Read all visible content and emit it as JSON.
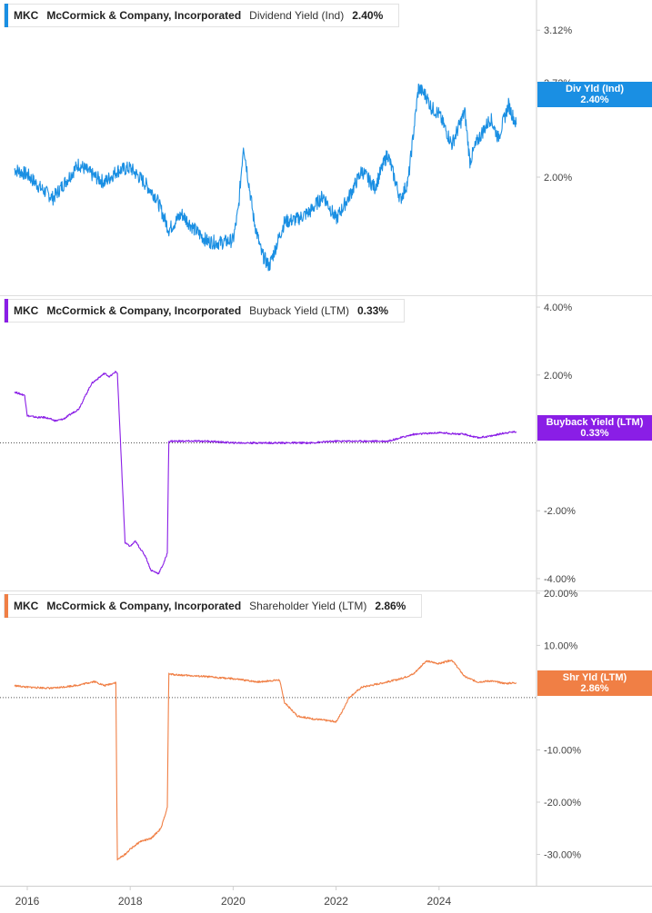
{
  "ticker": "MKC",
  "company": "McCormick & Company, Incorporated",
  "panels": [
    {
      "metric": "Dividend Yield (Ind)",
      "value": "2.40%",
      "badge_label": "Div Yld (Ind)",
      "badge_value": "2.40%",
      "color": "#1a8fe3"
    },
    {
      "metric": "Buyback Yield (LTM)",
      "value": "0.33%",
      "badge_label": "Buyback Yield (LTM)",
      "badge_value": "0.33%",
      "color": "#8a1ee6"
    },
    {
      "metric": "Shareholder Yield (LTM)",
      "value": "2.86%",
      "badge_label": "Shr Yld (LTM)",
      "badge_value": "2.86%",
      "color": "#f07f45"
    }
  ],
  "chart_data": [
    {
      "type": "line",
      "title": "MKC McCormick & Company, Incorporated Dividend Yield (Ind) 2.40%",
      "series": [
        {
          "name": "Div Yld (Ind)",
          "color": "#1a8fe3",
          "x": [
            2015.75,
            2016.0,
            2016.25,
            2016.5,
            2016.75,
            2017.0,
            2017.25,
            2017.5,
            2017.75,
            2018.0,
            2018.25,
            2018.5,
            2018.75,
            2019.0,
            2019.25,
            2019.5,
            2019.75,
            2020.0,
            2020.1,
            2020.2,
            2020.4,
            2020.55,
            2020.7,
            2020.9,
            2021.0,
            2021.25,
            2021.5,
            2021.75,
            2022.0,
            2022.25,
            2022.5,
            2022.75,
            2023.0,
            2023.25,
            2023.4,
            2023.6,
            2023.75,
            2023.85,
            2024.0,
            2024.25,
            2024.5,
            2024.6,
            2024.75,
            2025.0,
            2025.15,
            2025.35,
            2025.5
          ],
          "y": [
            2.06,
            2.02,
            1.92,
            1.84,
            1.97,
            2.1,
            2.02,
            1.96,
            2.05,
            2.07,
            1.97,
            1.85,
            1.6,
            1.72,
            1.6,
            1.51,
            1.5,
            1.52,
            1.75,
            2.25,
            1.68,
            1.42,
            1.32,
            1.55,
            1.66,
            1.68,
            1.74,
            1.86,
            1.68,
            1.85,
            2.05,
            1.92,
            2.18,
            1.83,
            1.97,
            2.68,
            2.62,
            2.53,
            2.48,
            2.25,
            2.5,
            2.12,
            2.28,
            2.45,
            2.3,
            2.55,
            2.4
          ]
        }
      ],
      "ylim": [
        1.1,
        3.35
      ],
      "yticks": [
        "2.00%",
        "2.72%",
        "3.12%"
      ],
      "ytick_values": [
        2.0,
        2.72,
        3.12
      ],
      "x_tick_labels": [
        "2016",
        "2018",
        "2020",
        "2022",
        "2024"
      ],
      "x_tick_values": [
        2016,
        2018,
        2020,
        2022,
        2024
      ]
    },
    {
      "type": "line",
      "title": "MKC McCormick & Company, Incorporated Buyback Yield (LTM) 0.33%",
      "series": [
        {
          "name": "Buyback Yield (LTM)",
          "color": "#8a1ee6",
          "x": [
            2015.75,
            2015.95,
            2016.0,
            2016.2,
            2016.35,
            2016.55,
            2016.7,
            2017.0,
            2017.25,
            2017.5,
            2017.6,
            2017.72,
            2017.75,
            2017.9,
            2018.0,
            2018.1,
            2018.3,
            2018.4,
            2018.55,
            2018.65,
            2018.72,
            2018.75,
            2019.0,
            2019.5,
            2020.0,
            2020.5,
            2021.0,
            2021.5,
            2022.0,
            2022.5,
            2023.0,
            2023.5,
            2024.0,
            2024.5,
            2024.75,
            2025.0,
            2025.3,
            2025.5
          ],
          "y": [
            1.5,
            1.4,
            0.8,
            0.75,
            0.75,
            0.65,
            0.7,
            1.0,
            1.75,
            2.05,
            1.95,
            2.1,
            2.05,
            -2.95,
            -3.05,
            -2.9,
            -3.35,
            -3.75,
            -3.85,
            -3.55,
            -3.25,
            0.05,
            0.05,
            0.05,
            0.0,
            0.0,
            0.0,
            0.0,
            0.05,
            0.05,
            0.05,
            0.25,
            0.3,
            0.25,
            0.15,
            0.2,
            0.3,
            0.33
          ]
        }
      ],
      "ylim": [
        -4.35,
        4.35
      ],
      "yticks": [
        "4.00%",
        "2.00%",
        "-2.00%",
        "-4.00%"
      ],
      "ytick_values": [
        4.0,
        2.0,
        -2.0,
        -4.0
      ],
      "baseline": 0
    },
    {
      "type": "line",
      "title": "MKC McCormick & Company, Incorporated Shareholder Yield (LTM) 2.86%",
      "series": [
        {
          "name": "Shr Yld (LTM)",
          "color": "#f07f45",
          "x": [
            2015.75,
            2016.0,
            2016.5,
            2017.0,
            2017.3,
            2017.5,
            2017.72,
            2017.75,
            2017.9,
            2018.0,
            2018.2,
            2018.4,
            2018.6,
            2018.72,
            2018.75,
            2019.0,
            2019.5,
            2020.0,
            2020.5,
            2020.7,
            2020.9,
            2021.0,
            2021.25,
            2021.5,
            2021.75,
            2022.0,
            2022.1,
            2022.25,
            2022.5,
            2023.0,
            2023.25,
            2023.5,
            2023.75,
            2024.0,
            2024.25,
            2024.5,
            2024.75,
            2025.0,
            2025.3,
            2025.5
          ],
          "y": [
            2.3,
            2.0,
            1.8,
            2.4,
            3.1,
            2.3,
            2.9,
            -31.0,
            -30.0,
            -29.0,
            -27.5,
            -27.0,
            -25.0,
            -21.0,
            4.5,
            4.3,
            4.0,
            3.6,
            3.0,
            3.2,
            3.4,
            -1.0,
            -3.5,
            -4.0,
            -4.3,
            -4.6,
            -3.0,
            0.0,
            2.0,
            3.0,
            3.6,
            4.5,
            7.0,
            6.5,
            7.2,
            4.0,
            3.0,
            3.2,
            2.7,
            2.86
          ]
        }
      ],
      "ylim": [
        -36.0,
        20.5
      ],
      "yticks": [
        "20.00%",
        "10.00%",
        "-10.00%",
        "-20.00%",
        "-30.00%"
      ],
      "ytick_values": [
        20.0,
        10.0,
        -10.0,
        -20.0,
        -30.0
      ],
      "baseline": 0
    }
  ]
}
